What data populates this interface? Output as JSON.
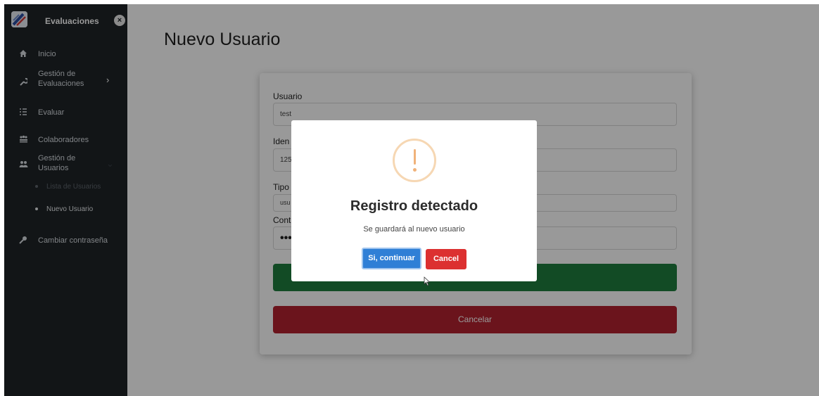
{
  "sidebar": {
    "brand_title": "Evaluaciones",
    "brand_logo": "logo-icon",
    "close_icon": "close-icon",
    "items": [
      {
        "label": "Inicio",
        "icon": "home-icon"
      },
      {
        "label": "Gestión de Evaluaciones",
        "label_line1": "Gestión de",
        "label_line2": "Evaluaciones",
        "icon": "wrench-icon",
        "chevron": "chevron-right-icon"
      },
      {
        "label": "Evaluar",
        "icon": "list-check-icon"
      },
      {
        "label": "Colaboradores",
        "icon": "users-group-icon"
      },
      {
        "label": "Gestión de Usuarios",
        "label_line1": "Gestión de",
        "label_line2": "Usuarios",
        "icon": "users-icon",
        "chevron": "chevron-down-icon"
      },
      {
        "label": "Cambiar contraseña",
        "icon": "key-icon"
      }
    ],
    "subitems": [
      {
        "label": "Lista de Usuarios"
      },
      {
        "label": "Nuevo Usuario"
      }
    ]
  },
  "main": {
    "page_title": "Nuevo Usuario",
    "form": {
      "usuario_label": "Usuario",
      "usuario_value": "test",
      "identificacion_label_visible": "Iden",
      "identificacion_value_visible": "125",
      "tipo_label_visible": "Tipo",
      "tipo_value_visible": "usu",
      "contrasena_label_visible": "Cont",
      "contrasena_value": "•••",
      "cancel_label": "Cancelar"
    }
  },
  "modal": {
    "icon": "warning-icon",
    "title": "Registro detectado",
    "text": "Se guardará al nuevo usuario",
    "confirm_label": "Si, continuar",
    "cancel_label": "Cancel"
  },
  "colors": {
    "sidebar_bg": "#1e2327",
    "submit_green": "#1e7e3e",
    "cancel_red": "#b3222f",
    "confirm_blue": "#2f7fd6",
    "modal_cancel_red": "#dc3030",
    "warning_orange": "#f0b27a"
  }
}
